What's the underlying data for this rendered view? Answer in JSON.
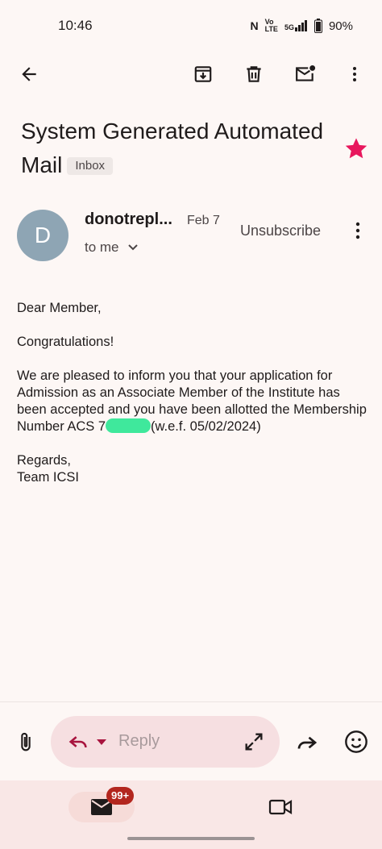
{
  "status_bar": {
    "time": "10:46",
    "nfc": "N",
    "volte_top": "Vo",
    "volte_bottom": "LTE",
    "network": "5G",
    "battery": "90%"
  },
  "email": {
    "subject": "System Generated Automated Mail",
    "label": "Inbox",
    "starred": true,
    "sender_initial": "D",
    "sender": "donotrepl...",
    "date": "Feb 7",
    "recipient": "to me",
    "unsubscribe": "Unsubscribe",
    "body": {
      "greeting": "Dear Member,",
      "congrats": "Congratulations!",
      "paragraph_part1": "We are pleased to inform you that your application for Admission as an Associate Member of the Institute has been accepted and you have been allotted the Membership Number ACS 7",
      "paragraph_part2": "(w.e.f. 05/02/2024)",
      "closing": "Regards,",
      "signature": "Team ICSI"
    }
  },
  "reply_bar": {
    "reply_placeholder": "Reply"
  },
  "bottom_nav": {
    "mail_badge": "99+"
  },
  "colors": {
    "background": "#fdf7f5",
    "star": "#e8175d",
    "avatar": "#8ea5b4",
    "reply_pill": "#f6dfe1",
    "badge": "#b3261e",
    "redaction": "#3fe89c"
  }
}
